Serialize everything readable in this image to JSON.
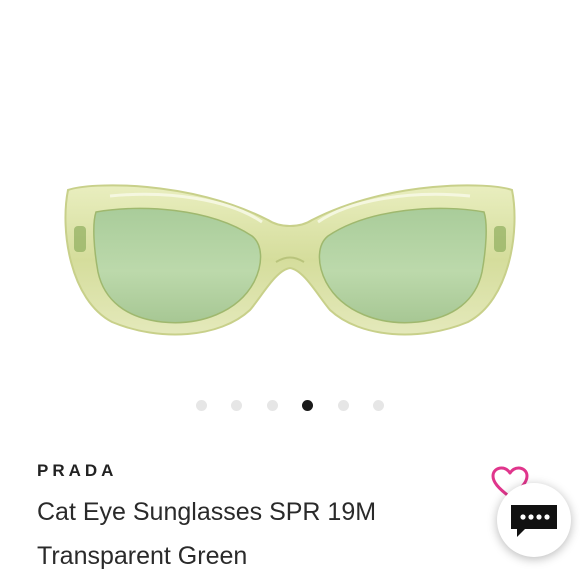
{
  "product": {
    "brand": "PRADA",
    "title_line1": "Cat Eye Sunglasses SPR 19M",
    "title_line2": "Transparent Green"
  },
  "carousel": {
    "dot_count": 6,
    "active_index": 3
  },
  "icons": {
    "like": "heart-icon",
    "chat": "chat-bubble-icon"
  },
  "colors": {
    "like_accent": "#e0358c",
    "dot_active": "#1a1a1a",
    "dot_inactive": "#e6e6e6",
    "chat_icon": "#111111"
  }
}
